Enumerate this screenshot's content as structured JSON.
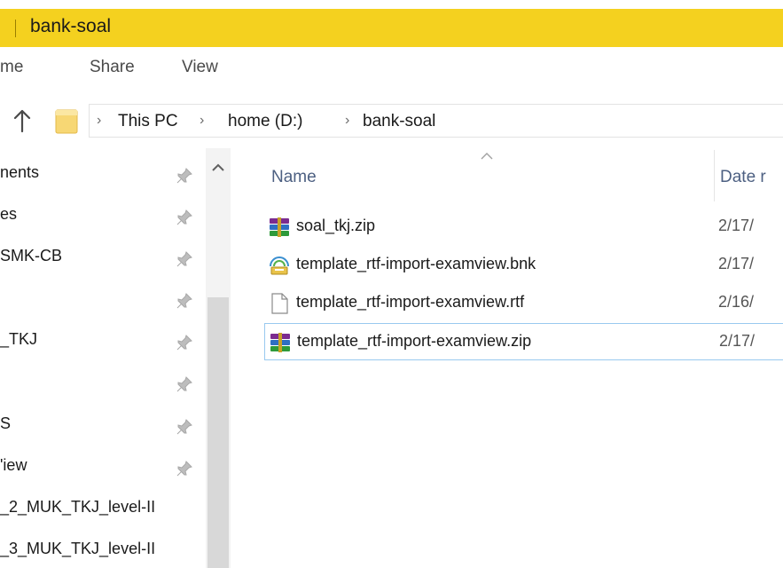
{
  "window": {
    "title": "bank-soal"
  },
  "ribbon": {
    "tabs": [
      {
        "label": "me"
      },
      {
        "label": "Share"
      },
      {
        "label": "View"
      }
    ]
  },
  "address": {
    "crumbs": [
      {
        "label": "This PC"
      },
      {
        "label": "home (D:)"
      },
      {
        "label": "bank-soal"
      }
    ]
  },
  "nav": {
    "items": [
      {
        "label": "nents",
        "pinned": true
      },
      {
        "label": "es",
        "pinned": true
      },
      {
        "label": "SMK-CB",
        "pinned": true
      },
      {
        "label": "",
        "pinned": true
      },
      {
        "label": "_TKJ",
        "pinned": true
      },
      {
        "label": "",
        "pinned": true
      },
      {
        "label": "S",
        "pinned": true
      },
      {
        "label": "'iew",
        "pinned": true
      },
      {
        "label": "_2_MUK_TKJ_level-II",
        "pinned": false
      },
      {
        "label": "_3_MUK_TKJ_level-II",
        "pinned": false
      }
    ]
  },
  "file_list": {
    "columns": {
      "name": "Name",
      "date": "Date r"
    },
    "files": [
      {
        "name": "soal_tkj.zip",
        "date": "2/17/",
        "icon": "winrar-archive-icon"
      },
      {
        "name": "template_rtf-import-examview.bnk",
        "date": "2/17/",
        "icon": "examview-bank-icon"
      },
      {
        "name": "template_rtf-import-examview.rtf",
        "date": "2/16/",
        "icon": "blank-document-icon"
      },
      {
        "name": "template_rtf-import-examview.zip",
        "date": "2/17/",
        "icon": "winrar-archive-icon",
        "selected": true
      }
    ]
  },
  "colors": {
    "title_bar": "#f4d11f",
    "selection_border": "#99c9ef",
    "column_header_text": "#4d6082",
    "folder": "#f7d774"
  }
}
